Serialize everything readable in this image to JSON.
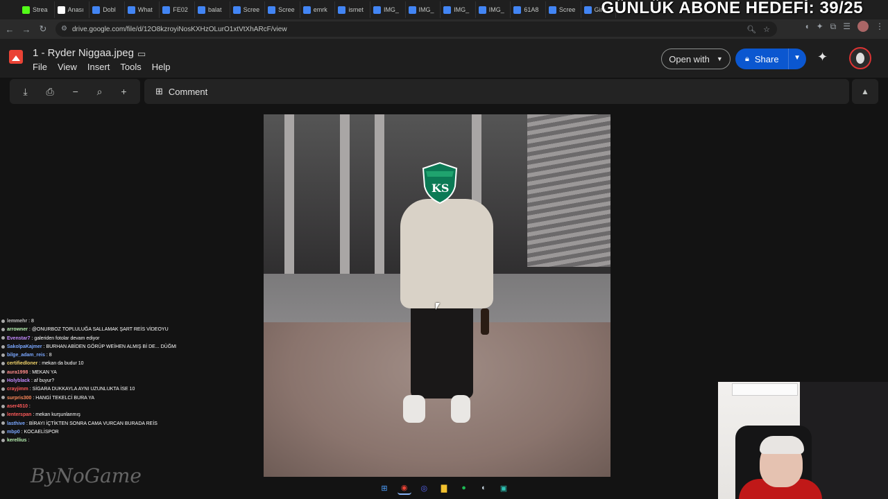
{
  "overlay": {
    "subscriber_goal": "GÜNLÜK ABONE HEDEFİ: 39/25"
  },
  "browser": {
    "tabs": [
      {
        "label": "Strea",
        "color": "#53fc18"
      },
      {
        "label": "Anası",
        "color": "#ffffff"
      },
      {
        "label": "Dobl",
        "color": "#4285f4"
      },
      {
        "label": "What",
        "color": "#4285f4"
      },
      {
        "label": "FE02",
        "color": "#4285f4"
      },
      {
        "label": "balat",
        "color": "#4285f4"
      },
      {
        "label": "Scree",
        "color": "#4285f4"
      },
      {
        "label": "Scree",
        "color": "#4285f4"
      },
      {
        "label": "emrk",
        "color": "#4285f4"
      },
      {
        "label": "ismet",
        "color": "#4285f4"
      },
      {
        "label": "IMG_",
        "color": "#4285f4"
      },
      {
        "label": "IMG_",
        "color": "#4285f4"
      },
      {
        "label": "IMG_",
        "color": "#4285f4"
      },
      {
        "label": "IMG_",
        "color": "#4285f4"
      },
      {
        "label": "61A8",
        "color": "#4285f4"
      },
      {
        "label": "Scree",
        "color": "#4285f4"
      },
      {
        "label": "Gira",
        "color": "#4285f4"
      }
    ],
    "url": "drive.google.com/file/d/12O8kzroyiNosKXHzOLurO1xtVtXhARcF/view"
  },
  "drive": {
    "file_title": "1 - Ryder Niggaa.jpeg",
    "menu": [
      "File",
      "View",
      "Insert",
      "Tools",
      "Help"
    ],
    "open_with_label": "Open with",
    "share_label": "Share",
    "share_color": "#0b57d0",
    "toolbar": {
      "comment_label": "Comment"
    },
    "icons": {
      "download": "download-icon",
      "print": "print-icon",
      "zoom_out": "minus-icon",
      "zoom": "magnifier-icon",
      "zoom_in": "plus-icon",
      "comment": "comment-add-icon",
      "collapse": "chevron-up-icon"
    }
  },
  "chat": {
    "messages": [
      {
        "user": "lemmehr",
        "text": "8",
        "color": "#c0c0c0"
      },
      {
        "user": "arrowner",
        "text": "@ONURBOZ TOPLULUĞA SALLAMAK ŞART REİS VİDEOYU",
        "color": "#b7f0b1"
      },
      {
        "user": "Evenstar7",
        "text": "galeriden fotolar devam ediyor",
        "color": "#c48bff"
      },
      {
        "user": "SakolpaKajmer",
        "text": "BURHAN ABİDEN GÖRÜP WEİHEN ALMIŞ Bİ DE... DÜĞMELER İNGİLİZ",
        "color": "#7aa7ff"
      },
      {
        "user": "bilge_adam_reis",
        "text": "8",
        "color": "#7aa7ff"
      },
      {
        "user": "certifiedloner",
        "text": "mekan da budur 10",
        "color": "#f0d36a"
      },
      {
        "user": "aura1998",
        "text": "MEKAN YA",
        "color": "#ff8a8a"
      },
      {
        "user": "Holyblack",
        "text": "af buyur?",
        "color": "#c48bff"
      },
      {
        "user": "crayjimm",
        "text": "SİGARA DUKKAYLA AYNI UZUNLUKTA İSE 10",
        "color": "#ff5a5a"
      },
      {
        "user": "surpris300",
        "text": "HANGİ TEKELCİ BURA YA",
        "color": "#ff8a5a"
      },
      {
        "user": "aser4510",
        "text": "",
        "color": "#ff5a5a"
      },
      {
        "user": "lenterspan",
        "text": "mekan kurşunlanmış",
        "color": "#ff5a5a"
      },
      {
        "user": "lasthive",
        "text": "BİRAYI İÇTİKTEN SONRA CAMA VURCAN BURADA REİS",
        "color": "#7aa7ff"
      },
      {
        "user": "mbp0",
        "text": "KOCAELİSPOR",
        "color": "#7aa7ff"
      },
      {
        "user": "kerellius",
        "text": "",
        "color": "#b7f0b1"
      }
    ]
  },
  "watermark": "ByNoGame",
  "taskbar": {
    "apps": [
      {
        "name": "windows-start-icon",
        "glyph": "⊞",
        "color": "#4ea0ff"
      },
      {
        "name": "chrome-icon",
        "glyph": "◉",
        "color": "#ea4335"
      },
      {
        "name": "discord-icon",
        "glyph": "◎",
        "color": "#5865f2"
      },
      {
        "name": "file-explorer-icon",
        "glyph": "▇",
        "color": "#f2c12e"
      },
      {
        "name": "spotify-icon",
        "glyph": "●",
        "color": "#1db954"
      },
      {
        "name": "steam-icon",
        "glyph": "◐",
        "color": "#c7d5e0"
      },
      {
        "name": "app-icon",
        "glyph": "▣",
        "color": "#2ec4b6"
      }
    ]
  }
}
